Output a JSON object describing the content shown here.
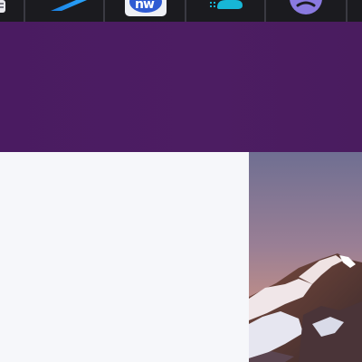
{
  "dock": {
    "apps": [
      {
        "name": "app-tile-icon"
      },
      {
        "name": "azure-devops-icon"
      },
      {
        "name": "news-app-icon",
        "badge": "nw"
      },
      {
        "name": "cloud-storage-icon"
      },
      {
        "name": "sad-face-app-icon"
      }
    ]
  },
  "colors": {
    "dock_bg": "#1b1b1f",
    "hero": "#4c1d62",
    "panel": "#f6f7fa",
    "accent_blue": "#1e88e5",
    "news_blue": "#2f5bd3",
    "cloud_teal": "#17b6d6",
    "face_purple": "#8a7ae0"
  },
  "photo": {
    "subject": "snowy-mountain-peak-at-dusk"
  }
}
